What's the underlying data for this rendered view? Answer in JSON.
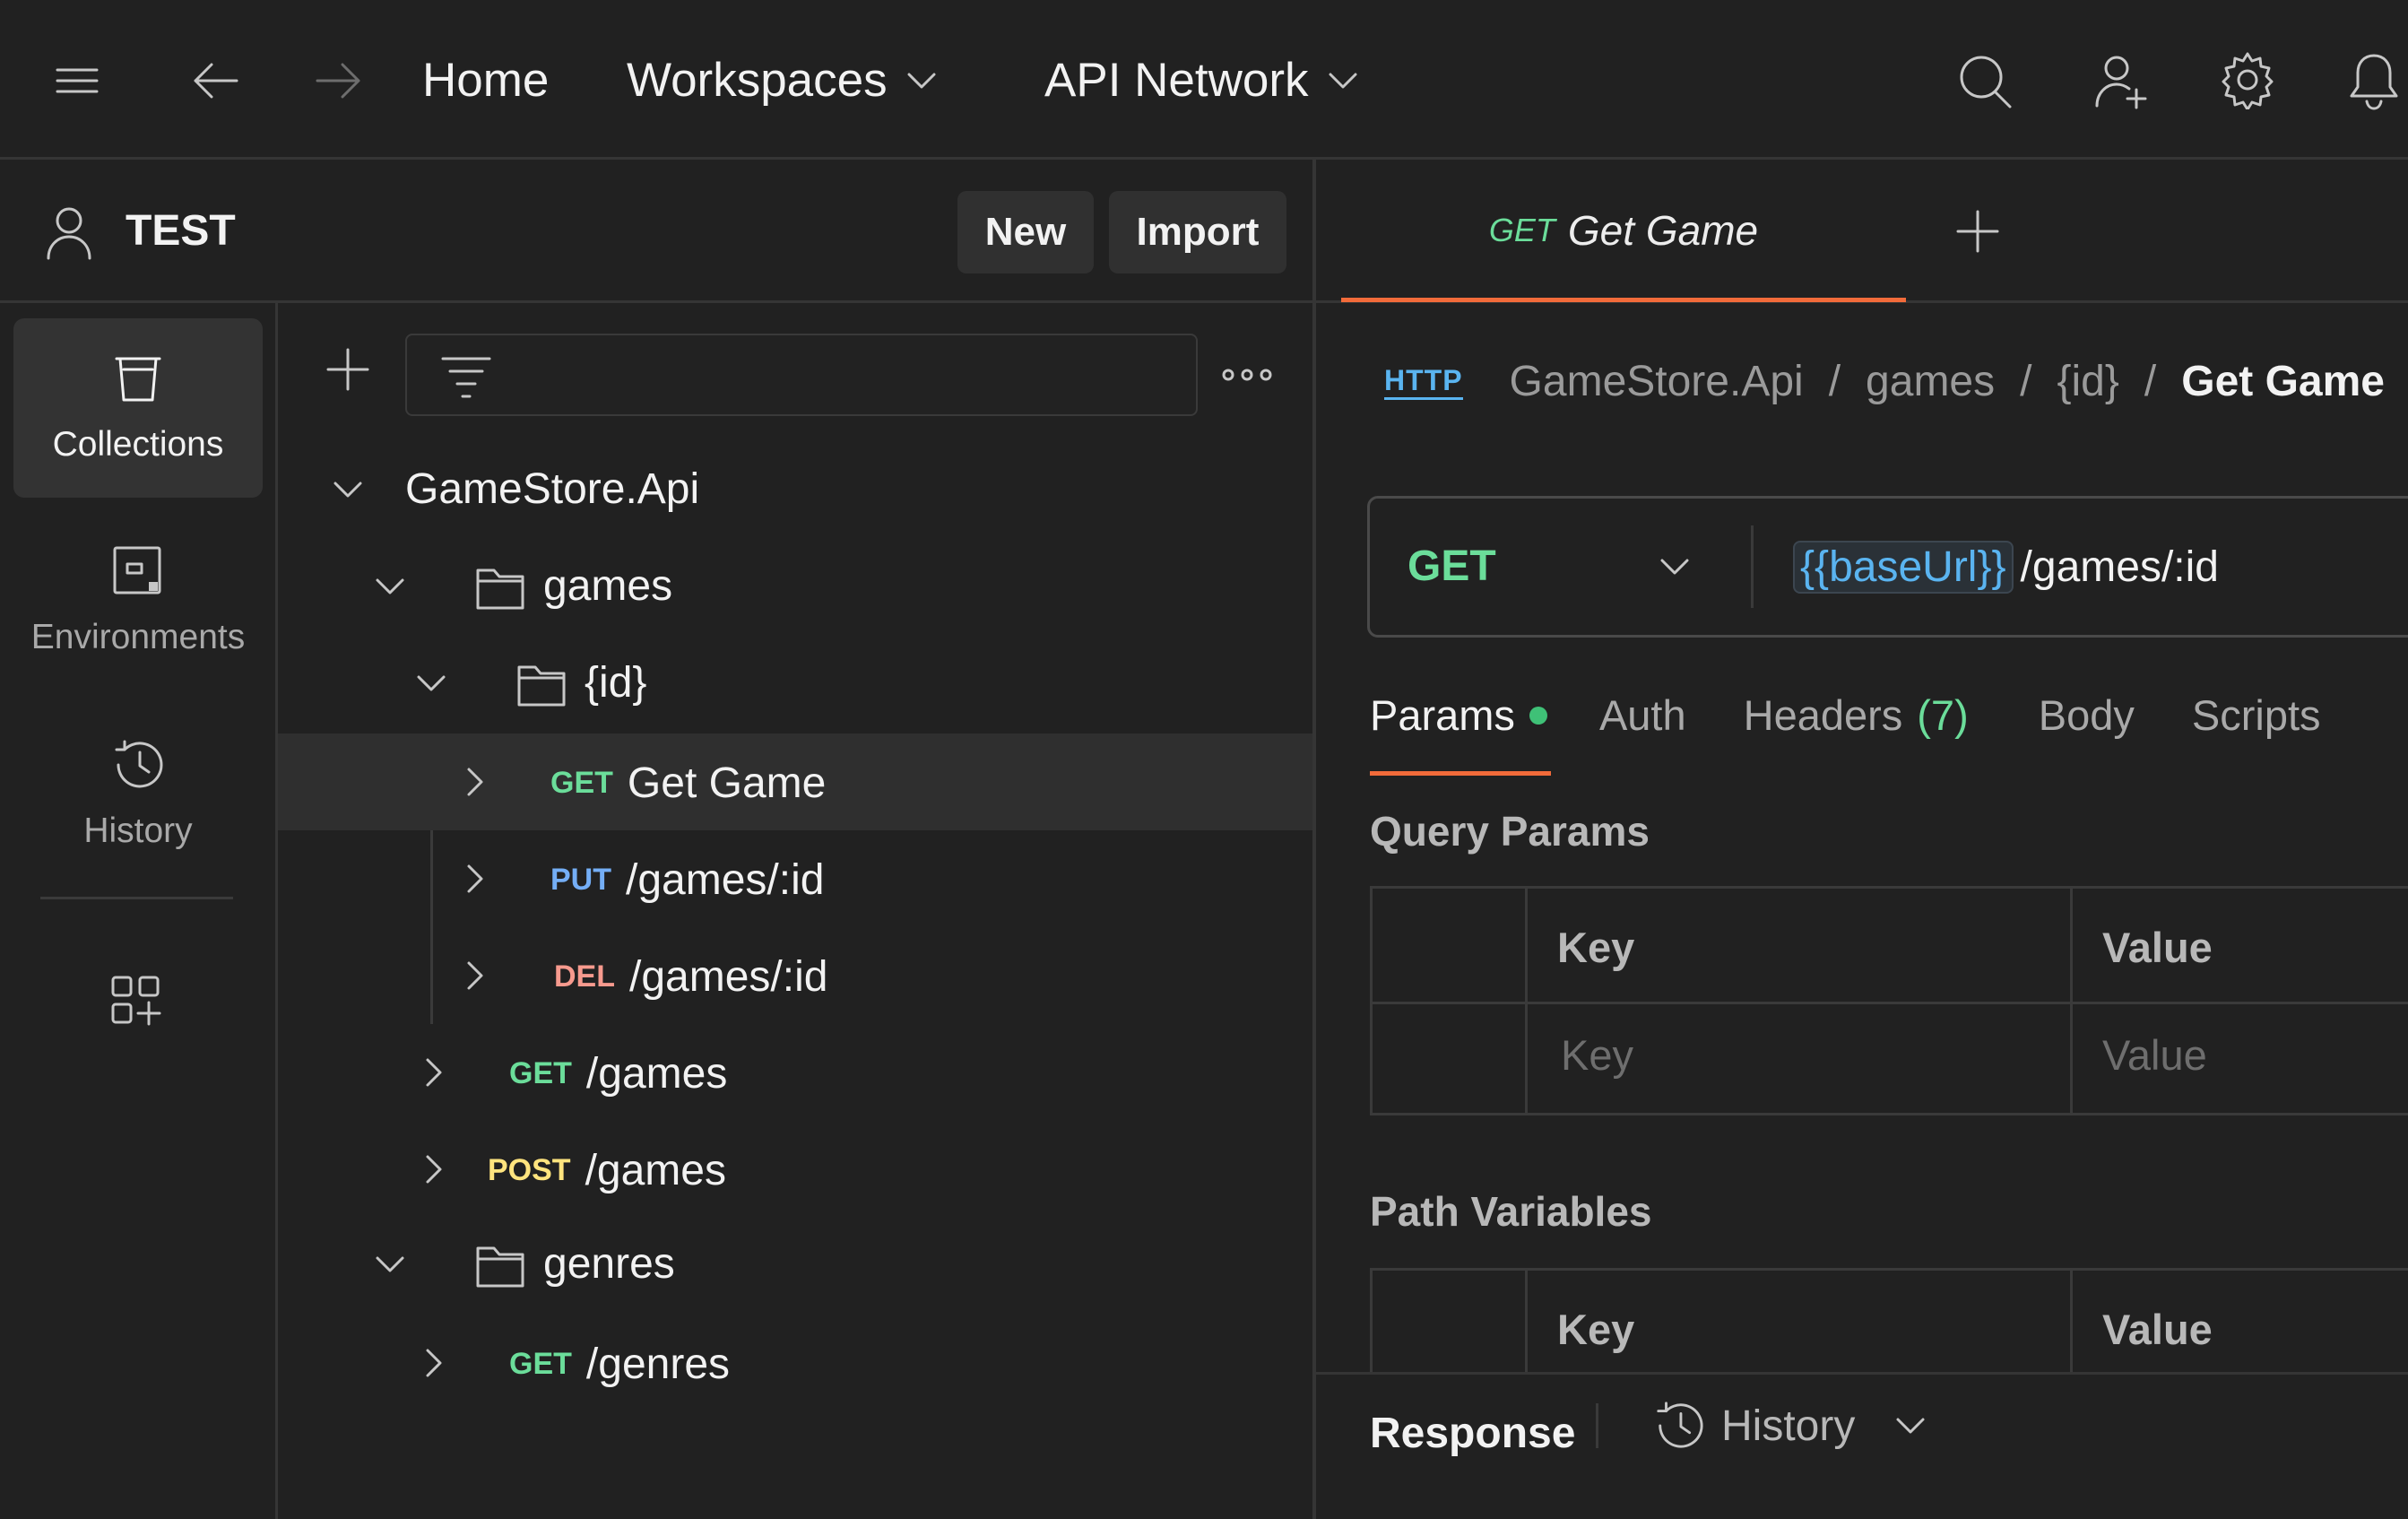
{
  "nav": {
    "home": "Home",
    "workspaces": "Workspaces",
    "api_network": "API Network"
  },
  "workspace": {
    "name": "TEST",
    "new_label": "New",
    "import_label": "Import"
  },
  "rail": {
    "collections": "Collections",
    "environments": "Environments",
    "history": "History"
  },
  "tree": {
    "collection": "GameStore.Api",
    "folder_games": "games",
    "folder_id": "{id}",
    "items": [
      {
        "method": "GET",
        "name": "Get Game"
      },
      {
        "method": "PUT",
        "name": "/games/:id"
      },
      {
        "method": "DEL",
        "name": "/games/:id"
      },
      {
        "method": "GET",
        "name": "/games"
      },
      {
        "method": "POST",
        "name": "/games"
      },
      {
        "method": "GET",
        "name": "/genres"
      }
    ],
    "folder_genres": "genres"
  },
  "tab": {
    "method": "GET",
    "title": "Get Game"
  },
  "breadcrumb": {
    "badge": "HTTP",
    "parts": [
      "GameStore.Api",
      "games",
      "{id}"
    ],
    "current": "Get Game",
    "sep": "/"
  },
  "request": {
    "method": "GET",
    "base_var": "{{baseUrl}}",
    "path": "/games/:id"
  },
  "req_tabs": {
    "params": "Params",
    "auth": "Auth",
    "headers": "Headers",
    "headers_count": "(7)",
    "body": "Body",
    "scripts": "Scripts"
  },
  "query_params": {
    "title": "Query Params",
    "col_key": "Key",
    "col_value": "Value",
    "key_placeholder": "Key",
    "value_placeholder": "Value"
  },
  "path_vars": {
    "title": "Path Variables",
    "col_key": "Key",
    "col_value": "Value"
  },
  "response": {
    "label": "Response",
    "history": "History"
  },
  "colors": {
    "get": "#6bdd9a",
    "put": "#74aef6",
    "del": "#f79a8e",
    "post": "#ffe47e",
    "accent": "#f26b3a",
    "var": "#5ab4f0"
  }
}
